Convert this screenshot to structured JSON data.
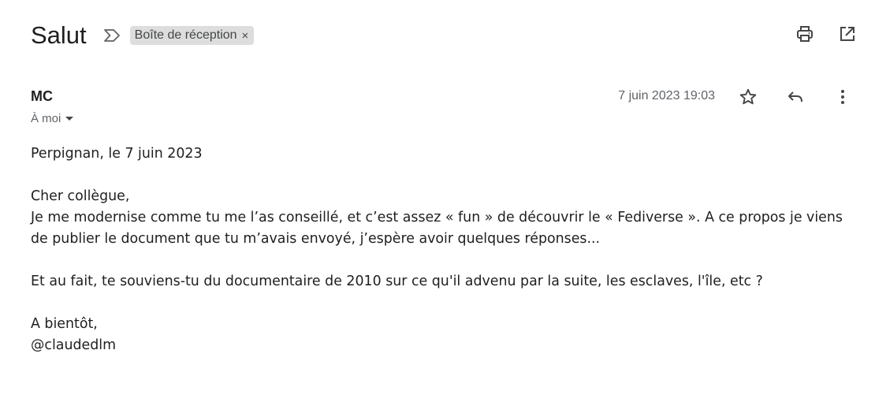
{
  "subject": "Salut",
  "label": {
    "text": "Boîte de réception",
    "close": "×"
  },
  "toolbar": {
    "print_icon": "print-icon",
    "popout_icon": "open-in-new-window-icon"
  },
  "message": {
    "sender": "MC",
    "recipient": "À moi",
    "date": "7 juin 2023 19:03",
    "body": {
      "line1": "Perpignan, le 7 juin 2023",
      "line2": "Cher collègue,",
      "line3": "Je me modernise comme tu me l’as conseillé, et c’est assez « fun » de découvrir le « Fediverse ». A ce propos je viens de publier le document que tu m’avais envoyé, j’espère avoir quelques réponses...",
      "line4": "Et au fait, te souviens-tu du documentaire de 2010 sur ce qu'il advenu par la suite, les esclaves, l'île, etc ?",
      "line5": "A bientôt,",
      "line6": "@claudedlm"
    }
  }
}
